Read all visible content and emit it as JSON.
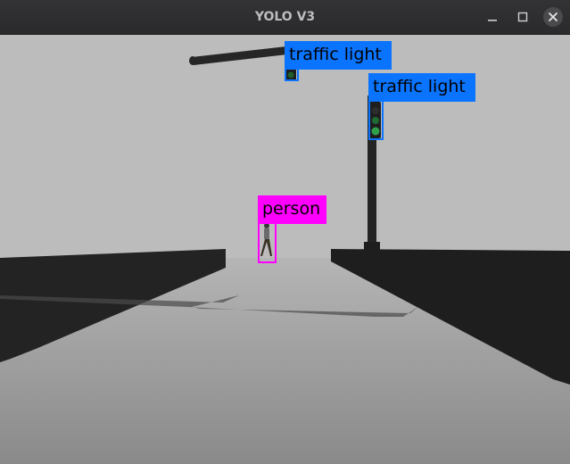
{
  "window": {
    "title": "YOLO V3"
  },
  "controls": {
    "minimize_icon": "minimize-icon",
    "maximize_icon": "maximize-icon",
    "close_icon": "close-icon"
  },
  "colors": {
    "traffic_light_box": "#0a74ff",
    "person_box": "#ff00ff",
    "sky": "#bdbdbd",
    "road": "#999999",
    "barrier": "#1f1f1f"
  },
  "detections": [
    {
      "class": "traffic light",
      "label": "traffic light"
    },
    {
      "class": "traffic light",
      "label": "traffic light"
    },
    {
      "class": "person",
      "label": "person"
    }
  ]
}
